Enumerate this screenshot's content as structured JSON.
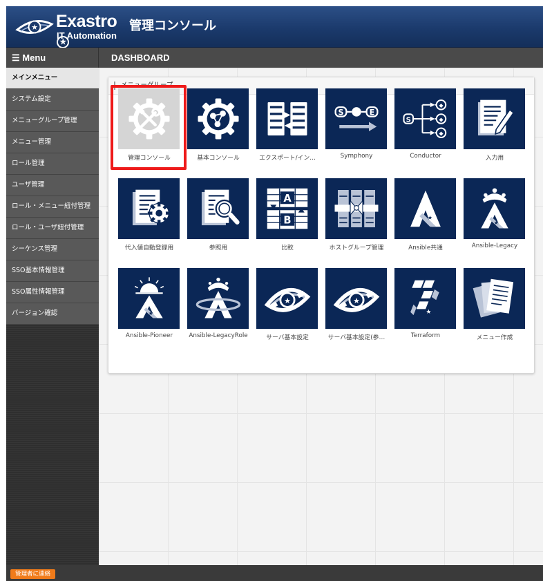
{
  "brand": {
    "name": "Exastro",
    "star_glyph": "★",
    "subtitle": "IT Automation"
  },
  "app_title": "管理コンソール",
  "menu_bar": {
    "label": "☰ Menu"
  },
  "breadcrumb": "DASHBOARD",
  "sidebar": {
    "items": [
      {
        "label": "メインメニュー",
        "active": true
      },
      {
        "label": "システム設定"
      },
      {
        "label": "メニューグループ管理"
      },
      {
        "label": "メニュー管理"
      },
      {
        "label": "ロール管理"
      },
      {
        "label": "ユーザ管理"
      },
      {
        "label": "ロール・メニュー紐付管理"
      },
      {
        "label": "ロール・ユーザ紐付管理"
      },
      {
        "label": "シーケンス管理"
      },
      {
        "label": "SSO基本情報管理"
      },
      {
        "label": "SSO属性情報管理"
      },
      {
        "label": "バージョン確認"
      }
    ]
  },
  "panel": {
    "title": "メニューグループ",
    "tiles": [
      {
        "label": "管理コンソール",
        "icon": "tools-gear-icon",
        "selected": true
      },
      {
        "label": "基本コンソール",
        "icon": "gear-network-icon"
      },
      {
        "label": "エクスポート/イン…",
        "icon": "export-import-icon"
      },
      {
        "label": "Symphony",
        "icon": "symphony-icon"
      },
      {
        "label": "Conductor",
        "icon": "conductor-icon"
      },
      {
        "label": "入力用",
        "icon": "document-pencil-icon"
      },
      {
        "label": "代入値自動登録用",
        "icon": "document-gear-icon"
      },
      {
        "label": "参照用",
        "icon": "document-search-icon"
      },
      {
        "label": "比較",
        "icon": "compare-icon"
      },
      {
        "label": "ホストグループ管理",
        "icon": "host-group-icon"
      },
      {
        "label": "Ansible共通",
        "icon": "ansible-icon"
      },
      {
        "label": "Ansible-Legacy",
        "icon": "ansible-crown-icon"
      },
      {
        "label": "Ansible-Pioneer",
        "icon": "ansible-sunrise-icon"
      },
      {
        "label": "Ansible-LegacyRole",
        "icon": "ansible-crown-ring-icon"
      },
      {
        "label": "サーバ基本設定",
        "icon": "server-eye-icon"
      },
      {
        "label": "サーバ基本設定(参…",
        "icon": "server-eye-icon"
      },
      {
        "label": "Terraform",
        "icon": "terraform-icon"
      },
      {
        "label": "メニュー作成",
        "icon": "menu-create-icon"
      }
    ]
  },
  "footer": {
    "contact_label": "管理者に連絡"
  },
  "colors": {
    "header": "#1b3a6c",
    "tile": "#0b2756",
    "selected_border": "#ee1a1a",
    "contact_button": "#f07b1a",
    "sidebar_item": "#595959"
  }
}
